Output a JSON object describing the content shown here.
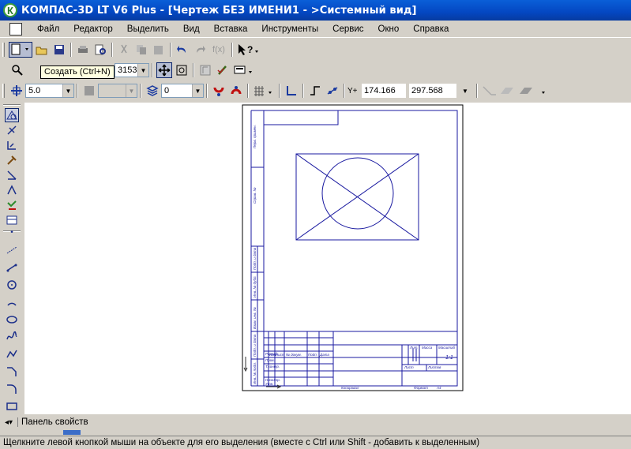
{
  "window": {
    "title": "КОМПАС-3D LT V6 Plus - [Чертеж БЕЗ ИМЕНИ1 - >Системный вид]",
    "app_icon": "К"
  },
  "menu": [
    {
      "label": "Файл"
    },
    {
      "label": "Редактор"
    },
    {
      "label": "Выделить"
    },
    {
      "label": "Вид"
    },
    {
      "label": "Вставка"
    },
    {
      "label": "Инструменты"
    },
    {
      "label": "Сервис"
    },
    {
      "label": "Окно"
    },
    {
      "label": "Справка"
    }
  ],
  "toolbar": {
    "tooltip": "Создать (Ctrl+N)",
    "scale_value": "3153",
    "step_value": "5.0",
    "layer_value": "0",
    "coord_x_label": "Y",
    "coord_x": "174.166",
    "coord_y": "297.568"
  },
  "drawing": {
    "stamp_labels": {
      "razrab": "Разраб.",
      "prov": "Пров.",
      "tkontr": "Т.контр.",
      "nkontr": "Н.контр.",
      "utv": "Утв.",
      "izm": "Изм.",
      "list": "Лист",
      "ndokum": "№ докум.",
      "podp": "Подп.",
      "data": "Дата",
      "lit": "Лит.",
      "massa": "Масса",
      "masshtab": "Масштаб",
      "list2": "Лист",
      "listov": "Листов",
      "scale": "1:1",
      "kopiroval": "Копировал",
      "format": "Формат",
      "format_value": "A4"
    },
    "side_labels": {
      "perv_primen": "Перв. примен.",
      "sprav": "Справ. №",
      "podp_data1": "Подп. и дата",
      "inv_dubl": "Инв. № дубл.",
      "vzam_inv": "Взам. инв. №",
      "podp_data2": "Подп. и дата",
      "inv_podl": "Инв. № подл."
    }
  },
  "panel": {
    "label": "Панель свойств"
  },
  "status": {
    "text": "Щелкните левой кнопкой мыши на объекте для его выделения (вместе с Ctrl или Shift - добавить к выделенным)"
  },
  "colors": {
    "drawing_blue": "#1a1aa0",
    "title_blue": "#0447c2"
  }
}
